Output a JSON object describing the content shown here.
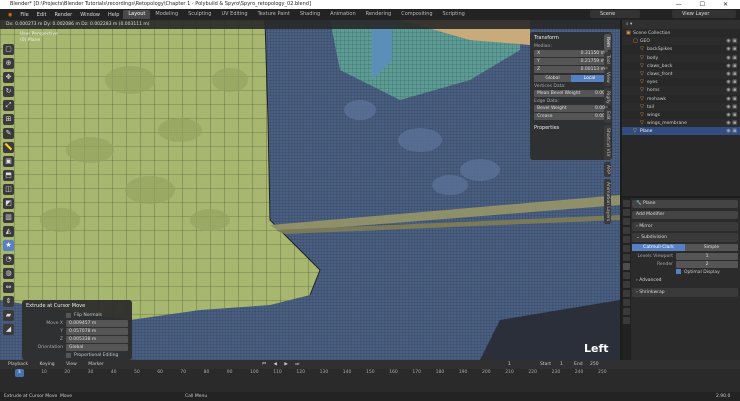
{
  "titlebar": {
    "title": "Blender* [D:\\Projects\\Blender Tutorials\\recordings\\Retopology\\Chapter 1 - Polybuild & Spyro\\Spyro_retopology_02.blend]"
  },
  "menu": {
    "items": [
      "File",
      "Edit",
      "Render",
      "Window",
      "Help"
    ],
    "tabs": [
      "Layout",
      "Modeling",
      "Sculpting",
      "UV Editing",
      "Texture Paint",
      "Shading",
      "Animation",
      "Rendering",
      "Compositing",
      "Scripting"
    ],
    "active_tab": "Layout",
    "scene": "Scene",
    "view_layer": "View Layer"
  },
  "viewport": {
    "header": "Dx: 0.000273 m  Dy: 0.002086 m  Dz: 0.002283 m (0.003111 m)",
    "perspective": "User Perspective",
    "object": "(0) Plane",
    "overlay_text": "Left",
    "n_tabs": [
      "Item",
      "Tool",
      "View",
      "Rigify",
      "Edit",
      "Shortcut VUr",
      "ARP",
      "Animation Layers"
    ]
  },
  "transform_panel": {
    "title": "Transform",
    "median_label": "Median:",
    "median": [
      {
        "axis": "X",
        "value": "0.31150 m"
      },
      {
        "axis": "Y",
        "value": "0.21759 m"
      },
      {
        "axis": "Z",
        "value": "0.00113 m"
      }
    ],
    "global_label": "Global",
    "local_label": "Local",
    "vertices_label": "Vertices Data:",
    "mean_bevel_label": "Mean Bevel Weight",
    "mean_bevel_value": "0.00",
    "edge_label": "Edge Data:",
    "bevel_weight_label": "Bevel Weight",
    "bevel_weight_value": "0.00",
    "crease_label": "Crease",
    "crease_value": "0.00",
    "properties_label": "Properties"
  },
  "operator_panel": {
    "title": "Extrude at Cursor Move",
    "flip_normals": "Flip Normals",
    "move": [
      {
        "label": "Move X",
        "value": "0.009457 m"
      },
      {
        "label": "Y",
        "value": "0.057078 m"
      },
      {
        "label": "Z",
        "value": "0.005338 m"
      }
    ],
    "orientation_label": "Orientation",
    "orientation_value": "Global",
    "proportional": "Proportional Editing"
  },
  "outliner": {
    "rows": [
      {
        "name": "Scene Collection",
        "indent": 0,
        "selected": false
      },
      {
        "name": "GEO",
        "indent": 1,
        "selected": false
      },
      {
        "name": "backSpikes",
        "indent": 2,
        "selected": false
      },
      {
        "name": "body",
        "indent": 2,
        "selected": false
      },
      {
        "name": "claws_back",
        "indent": 2,
        "selected": false
      },
      {
        "name": "claws_front",
        "indent": 2,
        "selected": false
      },
      {
        "name": "eyes",
        "indent": 2,
        "selected": false
      },
      {
        "name": "horns",
        "indent": 2,
        "selected": false
      },
      {
        "name": "mohawk",
        "indent": 2,
        "selected": false
      },
      {
        "name": "tail",
        "indent": 2,
        "selected": false
      },
      {
        "name": "wings",
        "indent": 2,
        "selected": false
      },
      {
        "name": "wings_membrane",
        "indent": 2,
        "selected": false
      },
      {
        "name": "Plane",
        "indent": 1,
        "selected": true
      }
    ]
  },
  "properties": {
    "object_name": "Plane",
    "add_modifier": "Add Modifier",
    "modifiers": [
      "Mirror",
      "Subdivision",
      "Shrinkwrap"
    ],
    "catmull": "Catmull-Clark",
    "simple": "Simple",
    "levels_viewport_label": "Levels Viewport",
    "levels_viewport_value": "1",
    "render_label": "Render",
    "render_value": "2",
    "optimal_display": "Optimal Display",
    "advanced": "Advanced"
  },
  "timeline": {
    "menus": [
      "Playback",
      "Keying",
      "View",
      "Marker"
    ],
    "current_frame": "1",
    "start_label": "Start",
    "start_value": "1",
    "end_label": "End",
    "end_value": "250",
    "ticks": [
      "0",
      "10",
      "20",
      "30",
      "40",
      "50",
      "60",
      "70",
      "80",
      "90",
      "100",
      "110",
      "120",
      "130",
      "140",
      "150",
      "160",
      "170",
      "180",
      "190",
      "200",
      "210",
      "220",
      "230",
      "240",
      "250"
    ]
  },
  "status": {
    "left": "Extrude at Cursor Move",
    "mid": "Move",
    "right_hint": "Call Menu",
    "version": "2.90.0"
  }
}
